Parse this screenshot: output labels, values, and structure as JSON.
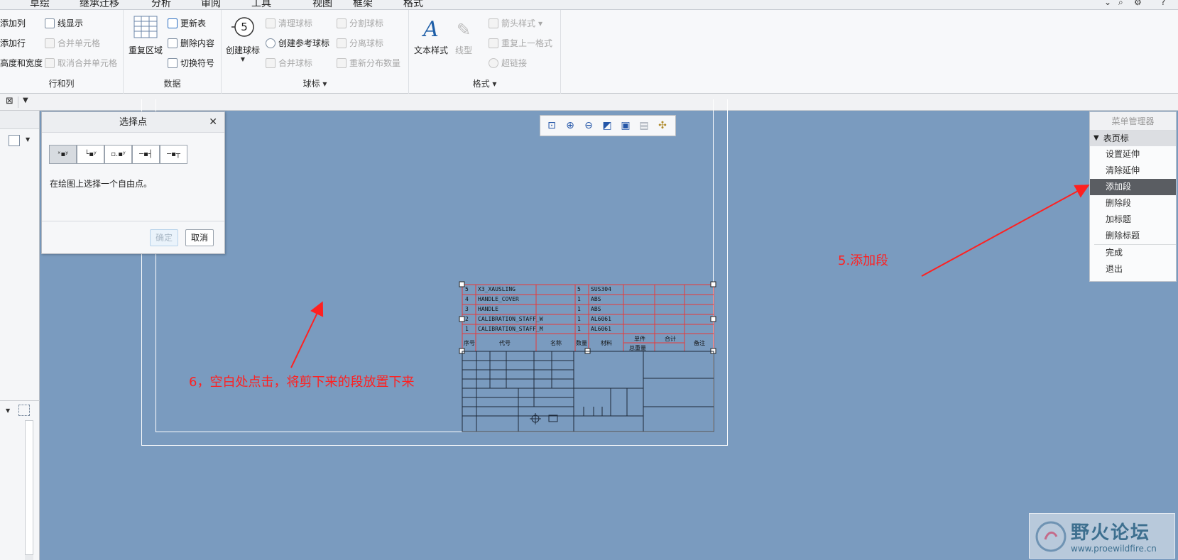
{
  "ribbon_tabs": [
    "草绘",
    "继承迁移",
    "分析",
    "审阅",
    "工具",
    "视图",
    "框架",
    "格式"
  ],
  "window_icons": [
    "minimize-icon",
    "search-icon",
    "settings-icon",
    "help-icon"
  ],
  "groups": {
    "rows_cols": {
      "label": "行和列",
      "items": [
        "添加列",
        "添加行",
        "高度和宽度"
      ],
      "items2": [
        "线显示",
        "合并单元格",
        "取消合并单元格"
      ]
    },
    "data": {
      "label": "数据",
      "big": "重复区域",
      "items": [
        "更新表",
        "删除内容",
        "切换符号"
      ]
    },
    "balloon": {
      "label": "球标",
      "big": "创建球标",
      "items": [
        "清理球标",
        "创建参考球标",
        "合并球标"
      ],
      "items2": [
        "分割球标",
        "分离球标",
        "重新分布数量"
      ]
    },
    "format": {
      "label": "格式",
      "big1": "文本样式",
      "big2": "线型",
      "items": [
        "箭头样式",
        "重复上一格式",
        "超链接"
      ]
    }
  },
  "dialog": {
    "title": "选择点",
    "instruction": "在绘图上选择一个自由点。",
    "ok_label": "确定",
    "cancel_label": "取消"
  },
  "menu_manager": {
    "title": "菜单管理器",
    "section": "表页标",
    "items": [
      "设置延伸",
      "清除延伸",
      "添加段",
      "删除段",
      "加标题",
      "删除标题"
    ],
    "active_index": 2,
    "done": "完成",
    "exit": "退出"
  },
  "annotations": {
    "step5": "5.添加段",
    "step6": "6，空白处点击，将剪下来的段放置下来"
  },
  "bom": {
    "rows": [
      [
        "5",
        "X3_XAUSLING",
        "",
        "5",
        "SUS304"
      ],
      [
        "4",
        "HANDLE_COVER",
        "",
        "1",
        "ABS"
      ],
      [
        "3",
        "HANDLE",
        "",
        "1",
        "ABS"
      ],
      [
        "2",
        "CALIBRATION_STAFF_W",
        "",
        "1",
        "AL6061"
      ],
      [
        "1",
        "CALIBRATION_STAFF_M",
        "",
        "1",
        "AL6061"
      ]
    ],
    "header": [
      "序号",
      "代号",
      "名称",
      "数量",
      "材料",
      "单件",
      "合计",
      "备注"
    ],
    "header_sub": "总重量"
  },
  "watermark": {
    "title": "野火论坛",
    "url": "www.proewildfire.cn"
  }
}
